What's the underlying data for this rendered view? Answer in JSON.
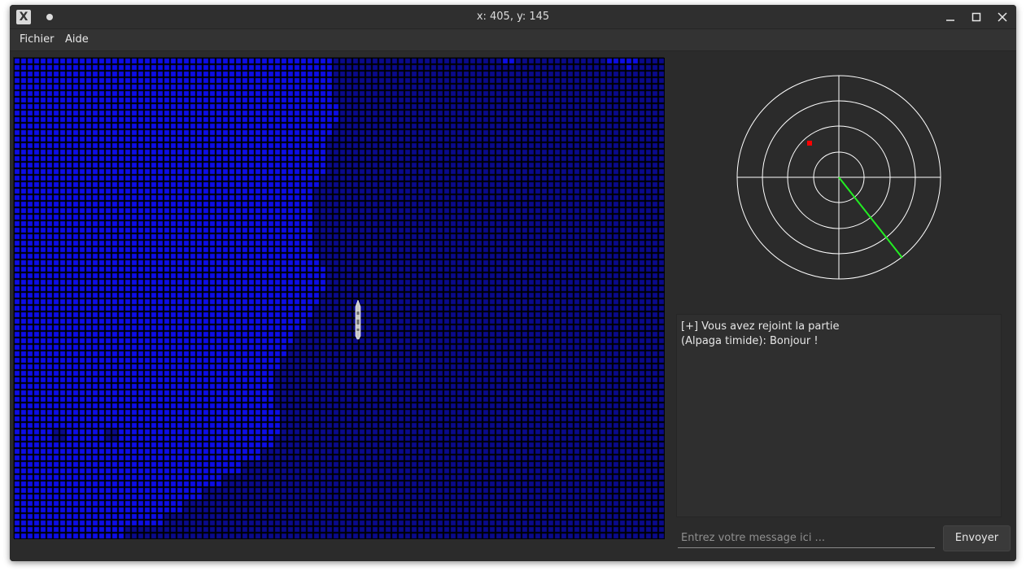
{
  "window": {
    "title": "x: 405, y: 145",
    "app_icon_glyph": "X"
  },
  "menu": {
    "items": [
      {
        "label": "Fichier"
      },
      {
        "label": "Aide"
      }
    ]
  },
  "colors": {
    "deep_water": "#0a0a8c",
    "shallow_water": "#0d0de8",
    "grid_line": "#000000",
    "radar_rings": "#ffffff",
    "radar_sweep": "#22ee22",
    "radar_contact": "#ff0000"
  },
  "chat": {
    "messages": [
      "[+] Vous avez rejoint la partie",
      "(Alpaga timide): Bonjour !"
    ],
    "input_placeholder": "Entrez votre message ici ...",
    "input_value": "",
    "send_label": "Envoyer"
  }
}
